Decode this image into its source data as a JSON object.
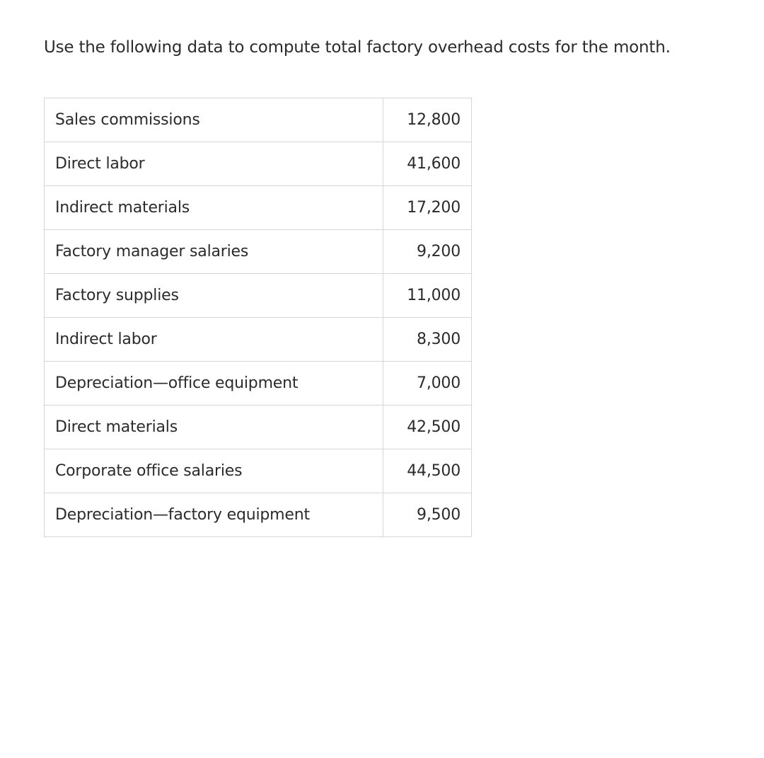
{
  "question": "Use the following data to compute total factory overhead costs for the month.",
  "rows": [
    {
      "label": "Sales commissions",
      "value": "12,800"
    },
    {
      "label": "Direct labor",
      "value": "41,600"
    },
    {
      "label": "Indirect materials",
      "value": "17,200"
    },
    {
      "label": "Factory manager salaries",
      "value": "9,200"
    },
    {
      "label": "Factory supplies",
      "value": "11,000"
    },
    {
      "label": "Indirect labor",
      "value": "8,300"
    },
    {
      "label": "Depreciation—office equipment",
      "value": "7,000"
    },
    {
      "label": "Direct materials",
      "value": "42,500"
    },
    {
      "label": "Corporate office salaries",
      "value": "44,500"
    },
    {
      "label": "Depreciation—factory equipment",
      "value": "9,500"
    }
  ]
}
